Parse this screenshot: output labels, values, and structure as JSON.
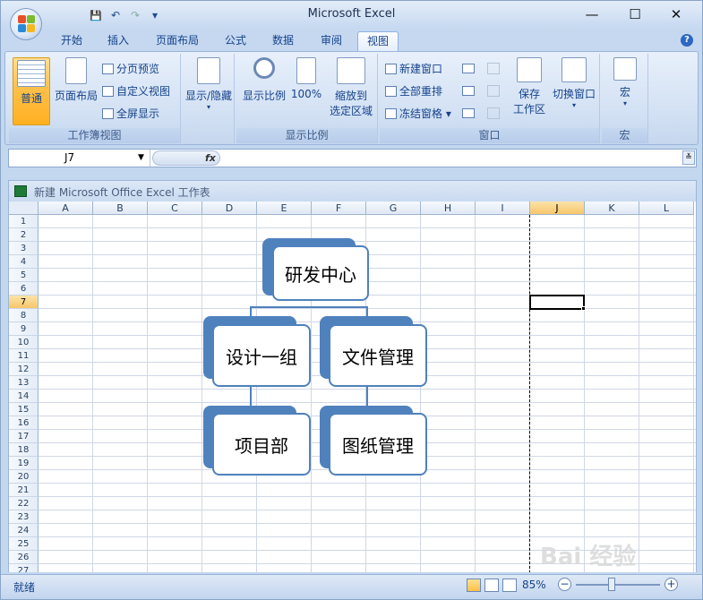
{
  "window": {
    "title": "Microsoft Excel",
    "minimize": "—",
    "maximize": "☐",
    "close": "✕"
  },
  "qat": {
    "save": "💾",
    "undo": "↶",
    "redo": "↷",
    "customize": "▾"
  },
  "tabs": [
    {
      "label": "开始"
    },
    {
      "label": "插入"
    },
    {
      "label": "页面布局"
    },
    {
      "label": "公式"
    },
    {
      "label": "数据"
    },
    {
      "label": "审阅"
    },
    {
      "label": "视图",
      "active": true
    }
  ],
  "ribbon": {
    "workbook_views": {
      "label": "工作簿视图",
      "normal": "普通",
      "page_layout": "页面布局",
      "page_break_preview": "分页预览",
      "custom_views": "自定义视图",
      "full_screen": "全屏显示"
    },
    "show_hide": {
      "label": "显示/隐藏"
    },
    "zoom": {
      "label": "显示比例",
      "zoom": "显示比例",
      "hundred": "100%",
      "zoom_selection_1": "缩放到",
      "zoom_selection_2": "选定区域"
    },
    "window": {
      "label": "窗口",
      "new_window": "新建窗口",
      "arrange_all": "全部重排",
      "freeze_panes": "冻结窗格",
      "save_workspace_1": "保存",
      "save_workspace_2": "工作区",
      "switch_windows": "切换窗口"
    },
    "macros": {
      "label": "宏",
      "macros": "宏"
    }
  },
  "formula_bar": {
    "name_box": "J7",
    "fx": "fx",
    "value": ""
  },
  "workbook": {
    "title": "新建 Microsoft Office Excel 工作表"
  },
  "columns": [
    "A",
    "B",
    "C",
    "D",
    "E",
    "F",
    "G",
    "H",
    "I",
    "J",
    "K",
    "L"
  ],
  "rows": [
    "1",
    "2",
    "3",
    "4",
    "5",
    "6",
    "7",
    "8",
    "9",
    "10",
    "11",
    "12",
    "13",
    "14",
    "15",
    "16",
    "17",
    "18",
    "19",
    "20",
    "21",
    "22",
    "23",
    "24",
    "25",
    "26",
    "27"
  ],
  "selected_cell": {
    "column": "J",
    "row": "7"
  },
  "smartart": {
    "root": "研发中心",
    "children": [
      {
        "label": "设计一组",
        "child": "项目部"
      },
      {
        "label": "文件管理",
        "child": "图纸管理"
      }
    ],
    "color": "#4f81bd"
  },
  "status": {
    "ready": "就绪",
    "zoom": "85%"
  },
  "watermark": "Bai 经验"
}
